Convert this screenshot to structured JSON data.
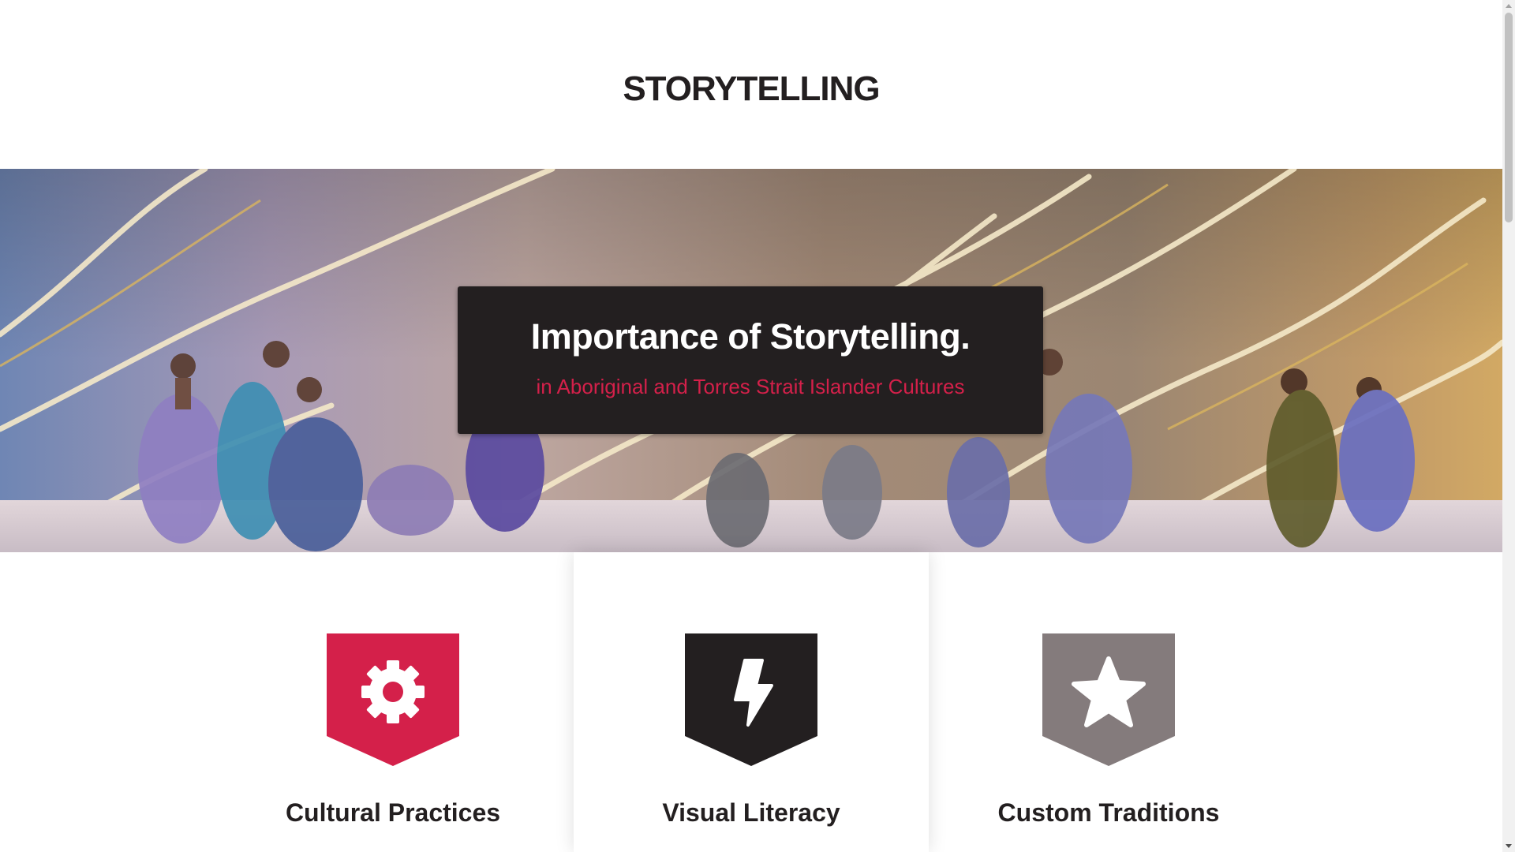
{
  "page": {
    "title": "STORYTELLING"
  },
  "hero": {
    "heading": "Importance of Storytelling.",
    "subheading": "in Aboriginal and Torres Strait Islander Cultures",
    "accent_color": "#d4204a",
    "card_color": "#231f20"
  },
  "features": [
    {
      "label": "Cultural Practices",
      "icon": "gear-icon",
      "color": "#d4204a"
    },
    {
      "label": "Visual Literacy",
      "icon": "lightning-icon",
      "color": "#231f20"
    },
    {
      "label": "Custom Traditions",
      "icon": "star-icon",
      "color": "#847b7c"
    }
  ]
}
